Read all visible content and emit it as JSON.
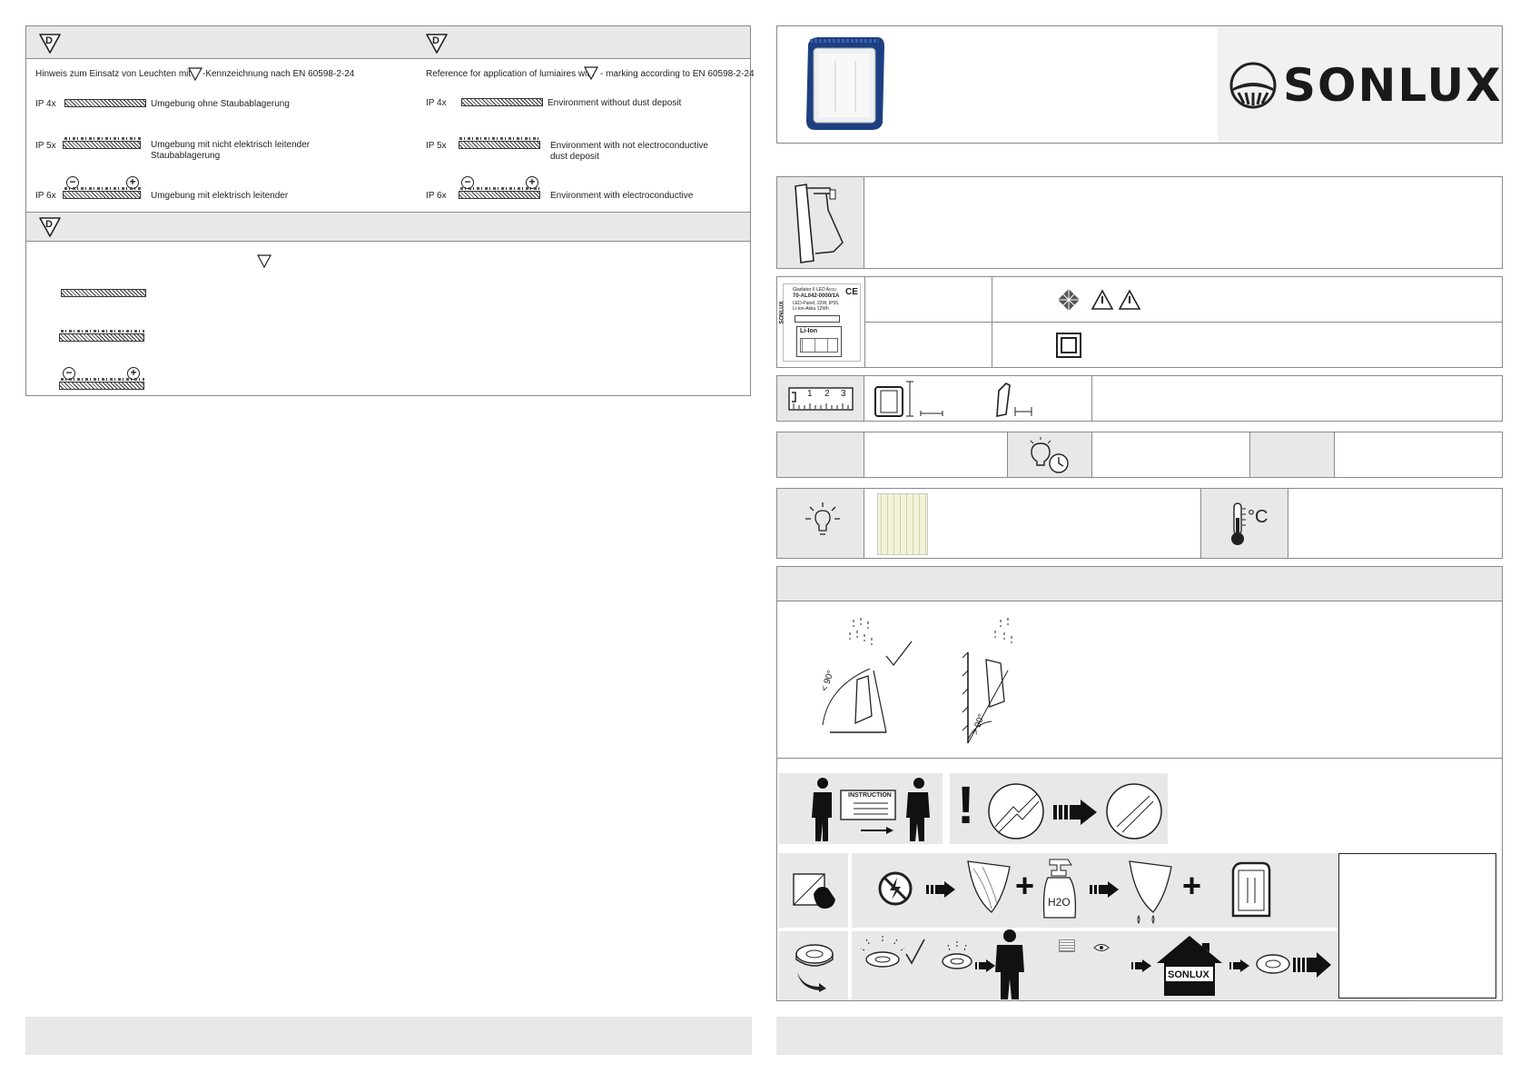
{
  "left_panel": {
    "de_note": "Hinweis zum Einsatz von Leuchten mit",
    "de_note_suffix": "-Kennzeichnung nach EN 60598-2-24",
    "en_note": "Reference for application of lumiaires with",
    "en_note_suffix": "- marking according to EN 60598-2-24",
    "badge_letter": "D",
    "rows_de": [
      {
        "code": "IP 4x",
        "text": "Umgebung ohne Staubablagerung"
      },
      {
        "code": "IP 5x",
        "text": "Umgebung mit nicht elektrisch leitender",
        "text2": "Staubablagerung"
      },
      {
        "code": "IP 6x",
        "text": "Umgebung mit elektrisch leitender"
      }
    ],
    "rows_en": [
      {
        "code": "IP 4x",
        "text": "Environment without dust deposit"
      },
      {
        "code": "IP 5x",
        "text": "Environment with not electroconductive",
        "text2": "dust deposit"
      },
      {
        "code": "IP 6x",
        "text": "Environment with electroconductive"
      }
    ]
  },
  "right_panel": {
    "brand": "SONLUX",
    "label_card": {
      "brand_vertical": "SONLUX",
      "line1": "Gladiator II LED Accu",
      "line2": "70-AL042-0000/1A",
      "line3": "LED-Panel, 22W, IP55,",
      "line4": "Li-Ion-Akku 12Wh",
      "battery": "Li-Ion"
    },
    "ruler_digits": [
      "1",
      "2",
      "3"
    ],
    "install_angles": {
      "left": "< 90°",
      "right": "> 90°"
    },
    "instruction_tag": "INSTRUCTION",
    "spray_label": "H2O",
    "house_label": "SONLUX",
    "thermo_unit": "°C"
  },
  "colors": {
    "panel_gray": "#e8e8e8",
    "border": "#8a8a8a",
    "product_blue": "#1d3f82"
  }
}
